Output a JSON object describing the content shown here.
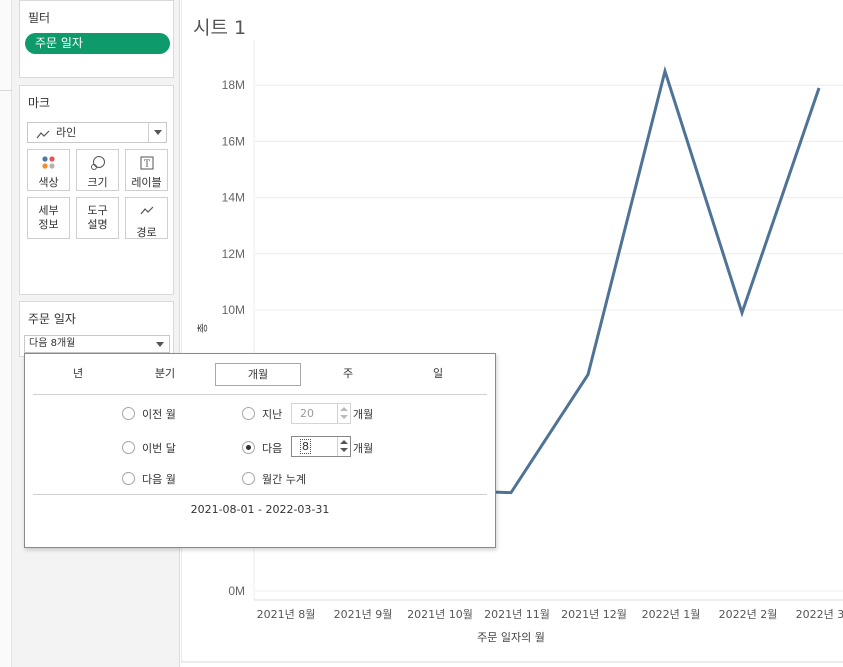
{
  "filters": {
    "title": "필터",
    "pill": "주문 일자"
  },
  "marks": {
    "title": "마크",
    "mark_type": "라인",
    "buttons": {
      "color": "색상",
      "size": "크기",
      "label": "레이블",
      "detail_1": "세부",
      "detail_2": "정보",
      "tooltip_1": "도구",
      "tooltip_2": "설명",
      "path": "경로"
    }
  },
  "date_filter": {
    "title": "주문 일자",
    "selected": "다음 8개월"
  },
  "sheet": {
    "title": "시트 1"
  },
  "popup": {
    "tabs": [
      "년",
      "분기",
      "개월",
      "주",
      "일"
    ],
    "active_tab": "개월",
    "options": {
      "prev": "이전 월",
      "this": "이번 달",
      "next": "다음 월",
      "last_n": "지난",
      "next_n": "다음",
      "to_date": "월간 누계"
    },
    "last_n_value": "20",
    "next_n_value": "8",
    "unit": "개월",
    "range_text": "2021-08-01 - 2022-03-31"
  },
  "colors": {
    "line": "#4e7396",
    "pill": "#0e9a6a",
    "grid": "#ececec"
  },
  "chart_data": {
    "type": "line",
    "title": "",
    "xlabel": "주문 일자의 월",
    "ylabel": "총",
    "y_ticks": [
      "0M",
      "10M",
      "12M",
      "14M",
      "16M",
      "18M"
    ],
    "ylim": [
      0,
      19.5
    ],
    "categories": [
      "2021년 8월",
      "2021년 9월",
      "2021년 10월",
      "2021년 11월",
      "2021년 12월",
      "2022년 1월",
      "2022년 2월",
      "2022년 3월"
    ],
    "series": [
      {
        "values": [
          null,
          null,
          3.6,
          3.5,
          7.7,
          18.5,
          9.9,
          17.9
        ]
      }
    ],
    "grid": true
  }
}
